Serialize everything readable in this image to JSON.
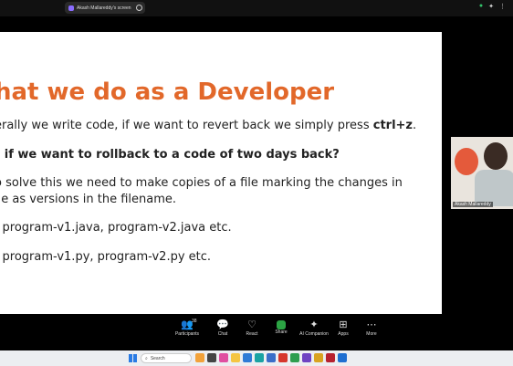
{
  "top_bar": {
    "share_label": "Akash Mallareddy's screen"
  },
  "slide": {
    "title": "hat we do as a Developer",
    "line1_prefix": "erally we write code, if we want to revert back we simply press ",
    "line1_bold": "ctrl+z",
    "line1_suffix": ".",
    "line2": "t if we want to rollback to a code of two days back?",
    "line3a": "o solve this we need to make copies of a file marking the changes in",
    "line3b": "ile as versions in the filename.",
    "line4": ": program-v1.java, program-v2.java etc.",
    "line5": ": program-v1.py, program-v2.py etc."
  },
  "video": {
    "name": "Akash Mallareddy"
  },
  "toolbar": {
    "items": [
      {
        "label": "Participants",
        "icon": "participants-icon",
        "count": "38"
      },
      {
        "label": "Chat",
        "icon": "chat-icon"
      },
      {
        "label": "React",
        "icon": "react-icon"
      },
      {
        "label": "Share",
        "icon": "share-icon"
      },
      {
        "label": "AI Companion",
        "icon": "ai-companion-icon"
      },
      {
        "label": "Apps",
        "icon": "apps-icon"
      },
      {
        "label": "More",
        "icon": "more-icon"
      }
    ]
  },
  "taskbar": {
    "search_placeholder": "Search"
  }
}
